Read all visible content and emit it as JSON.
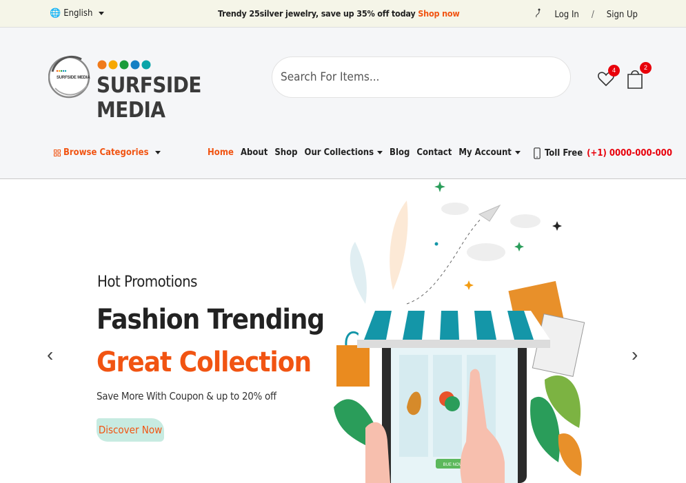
{
  "topbar": {
    "language": "English",
    "promo_text": "Trendy 25silver jewelry, save up 35% off today",
    "promo_link": "Shop now",
    "login": "Log In",
    "separator": "/",
    "signup": "Sign Up"
  },
  "header": {
    "logo_text": "SURFSIDE MEDIA",
    "logo_badge_text": "SURFSIDE MEDIA",
    "search_placeholder": "Search For Items...",
    "wishlist_count": "4",
    "cart_count": "2"
  },
  "nav": {
    "browse_label": "Browse Categories",
    "items": [
      {
        "label": "Home",
        "active": true
      },
      {
        "label": "About"
      },
      {
        "label": "Shop"
      },
      {
        "label": "Our Collections",
        "dropdown": true
      },
      {
        "label": "Blog"
      },
      {
        "label": "Contact"
      },
      {
        "label": "My Account",
        "dropdown": true
      }
    ],
    "toll_free_label": "Toll Free",
    "toll_free_number": "(+1) 0000-000-000"
  },
  "hero": {
    "subtitle": "Hot Promotions",
    "title": "Fashion Trending",
    "title_highlight": "Great Collection",
    "description": "Save More With Coupon & up to 20% off",
    "button": "Discover Now",
    "illustration_button": "BUE NOW",
    "prev_arrow": "‹",
    "next_arrow": "›"
  },
  "colors": {
    "accent": "#f15412",
    "topbar_bg": "#f5f5e8",
    "header_bg": "#f5f6f8",
    "badge": "#e8000b",
    "button_bg": "#c7ebe1",
    "awning_teal": "#1496a8"
  }
}
